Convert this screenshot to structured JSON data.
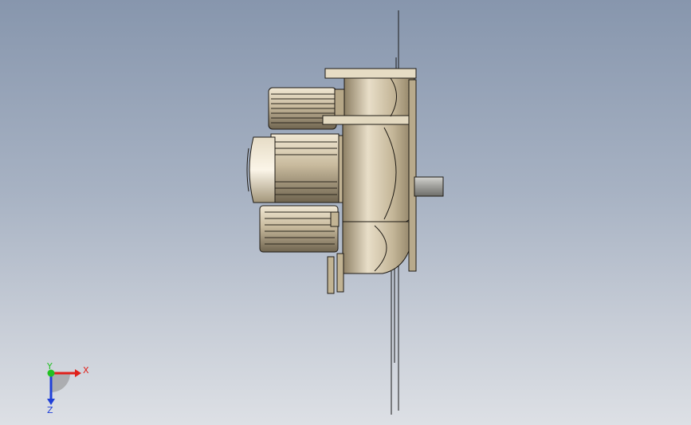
{
  "viewport": {
    "background_top": "#8796ad",
    "background_bottom": "#dde0e5"
  },
  "model": {
    "icon": "gear-motor-model",
    "body_color": "#c6b89c",
    "shade_color": "#8a7c62",
    "edge_color": "#1e1a14"
  },
  "triad": {
    "x_label": "X",
    "y_label": "Y",
    "z_label": "Z",
    "x_color": "#e0201a",
    "y_color": "#22c122",
    "z_color": "#2040d8"
  }
}
